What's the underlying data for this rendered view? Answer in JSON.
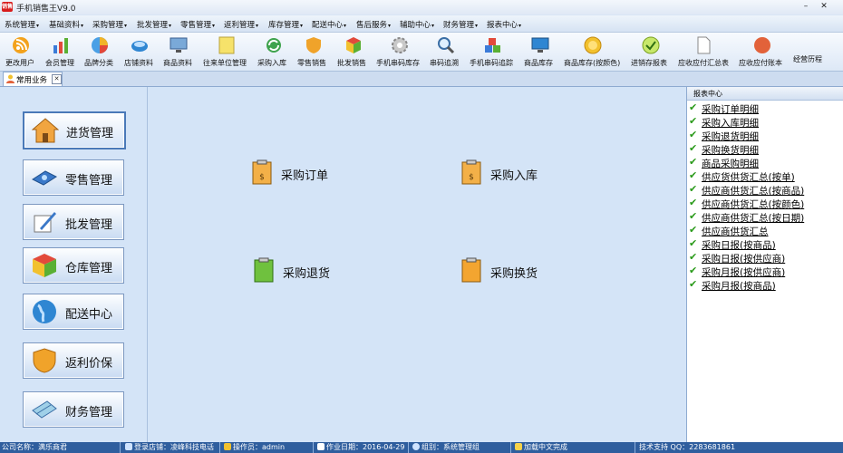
{
  "window": {
    "title": "手机销售王V9.0",
    "logo_text": "销售",
    "min": "–",
    "close": "✕"
  },
  "menu": [
    "系统管理",
    "基础资料",
    "采购管理",
    "批发管理",
    "零售管理",
    "返利管理",
    "库存管理",
    "配送中心",
    "售后服务",
    "辅助中心",
    "财务管理",
    "报表中心"
  ],
  "toolbar": [
    "更改用户",
    "会员管理",
    "品牌分类",
    "店铺资料",
    "商品资料",
    "往来单位管理",
    "采购入库",
    "零售销售",
    "批发销售",
    "手机串码库存",
    "串码追溯",
    "手机串码追踪",
    "商品库存",
    "商品库存(按颜色)",
    "进销存报表",
    "应收应付汇总表",
    "应收应付账本",
    "经营历程"
  ],
  "tab": {
    "label": "常用业务",
    "close": "✕"
  },
  "left_nav": [
    "进货管理",
    "零售管理",
    "批发管理",
    "仓库管理",
    "配送中心",
    "返利价保",
    "财务管理"
  ],
  "center_links": [
    "采购订单",
    "采购入库",
    "采购退货",
    "采购换货"
  ],
  "reports": {
    "title": "报表中心",
    "items": [
      "采购订单明细",
      "采购入库明细",
      "采购退货明细",
      "采购换货明细",
      "商品采购明细",
      "供应货供货汇总(按单)",
      "供应商供货汇总(按商品)",
      "供应商供货汇总(按颜色)",
      "供应商供货汇总(按日期)",
      "供应商供货汇总",
      "采购日报(按商品)",
      "采购日报(按供应商)",
      "采购月报(按供应商)",
      "采购月报(按商品)"
    ]
  },
  "status": {
    "company": "公司名称：满乐商君",
    "store": "登录店铺：凌峰科技电话",
    "operator": "操作员：admin",
    "date": "作业日期：2016-04-29",
    "group": "组别：系统管理组",
    "lang": "加载中文完成",
    "support": "技术支持 QQ：2283681861"
  }
}
